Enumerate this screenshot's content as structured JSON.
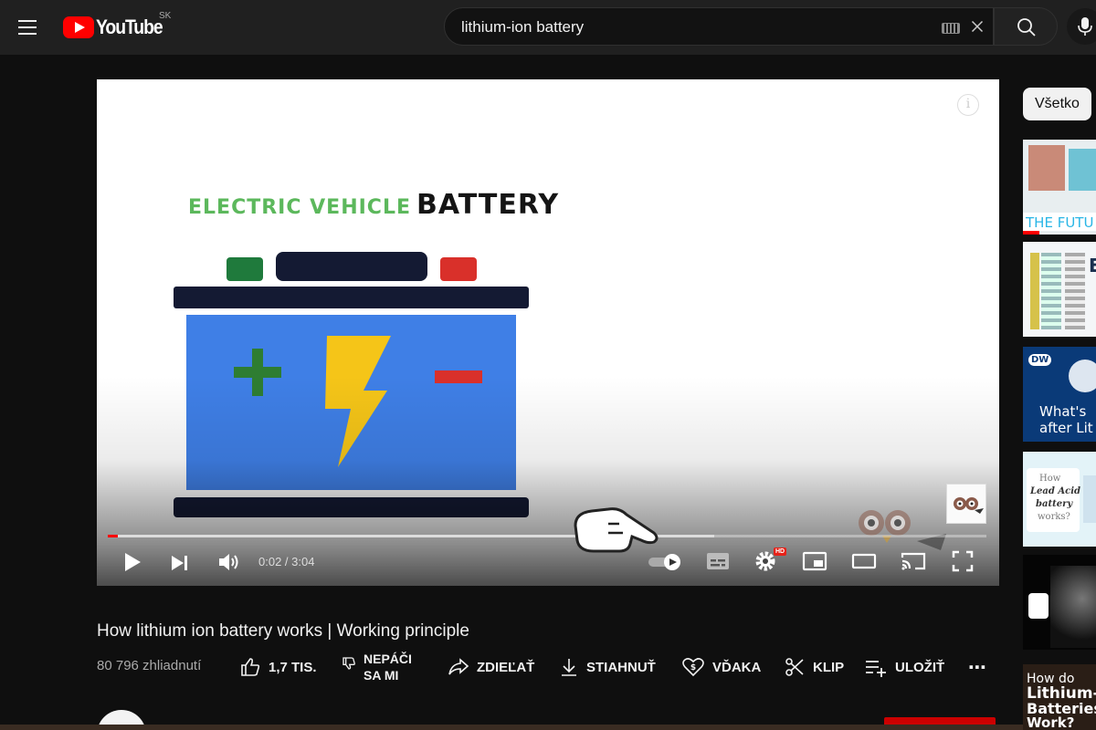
{
  "header": {
    "logo_text": "YouTube",
    "country_code": "SK",
    "search_value": "lithium-ion battery"
  },
  "player": {
    "slide_title_green": "ELECTRIC VEHICLE",
    "slide_title_black": "BATTERY",
    "time_current": "0:02",
    "time_total": "3:04",
    "time_display": "0:02 / 3:04",
    "progress_played": 0.011,
    "progress_loaded": 0.69,
    "hd_badge": "HD",
    "info_glyph": "i",
    "autoplay_on": false,
    "colors": {
      "terminal_plus": "#1f7a3c",
      "terminal_minus": "#d9302a",
      "battery_cap": "#141a33",
      "battery_body": "#3f7fe6",
      "plus_sign": "#2e7d32",
      "minus_sign": "#d9302a",
      "bolt": "#f5c518",
      "progress": "#ff0000"
    }
  },
  "video": {
    "title": "How lithium ion battery works | Working principle",
    "views": "80 796 zhliadnutí",
    "actions": {
      "like_count": "1,7 TIS.",
      "dislike_line1": "NEPÁČI",
      "dislike_line2": "SA MI",
      "share": "ZDIEĽAŤ",
      "download": "STIAHNUŤ",
      "thanks": "VĎAKA",
      "clip": "KLIP",
      "save": "ULOŽIŤ",
      "more": "⋯"
    }
  },
  "sidebar": {
    "chip_all": "Všetko",
    "thumbnails": [
      {
        "name": "future",
        "text": "THE FUTU"
      },
      {
        "name": "diagram",
        "text": "E"
      },
      {
        "name": "dw",
        "badge": "DW",
        "line1": "What's",
        "line2": "after Lit"
      },
      {
        "name": "lead-acid",
        "line1": "How",
        "line2": "Lead Acid",
        "line3": "battery",
        "line4": "works?"
      },
      {
        "name": "dark",
        "text": ""
      },
      {
        "name": "how-do",
        "line1": "How do",
        "line2": "Lithium-i",
        "line3": "Batteries",
        "line4": "Work?"
      }
    ]
  }
}
